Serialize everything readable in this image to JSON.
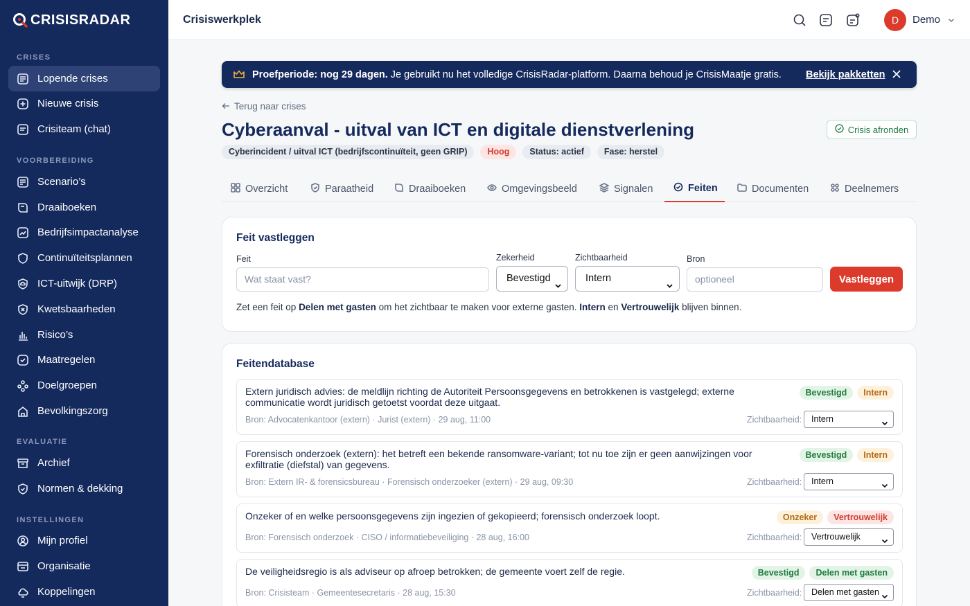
{
  "app": {
    "brand": "CRISISRADAR",
    "workspace_title": "Crisiswerkplek",
    "user_initial": "D",
    "user_name": "Demo",
    "accent": "#dc3b2c",
    "navy": "#14295c"
  },
  "sidebar": {
    "sections": [
      {
        "title": "CRISES",
        "items": [
          {
            "label": "Lopende crises",
            "icon": "list-alert-icon",
            "active": true
          },
          {
            "label": "Nieuwe crisis",
            "icon": "plus-circle-icon"
          },
          {
            "label": "Crisiteam (chat)",
            "icon": "chat-icon"
          }
        ]
      },
      {
        "title": "VOORBEREIDING",
        "items": [
          {
            "label": "Scenario’s",
            "icon": "scenario-icon"
          },
          {
            "label": "Draaiboeken",
            "icon": "book-icon"
          },
          {
            "label": "Bedrijfsimpactanalyse",
            "icon": "impact-icon"
          },
          {
            "label": "Continuïteitsplannen",
            "icon": "shield-icon"
          },
          {
            "label": "ICT-uitwijk (DRP)",
            "icon": "shield-cloud-icon"
          },
          {
            "label": "Kwetsbaarheden",
            "icon": "shield-x-icon"
          },
          {
            "label": "Risico’s",
            "icon": "bar-chart-icon"
          },
          {
            "label": "Maatregelen",
            "icon": "check-badge-icon"
          },
          {
            "label": "Doelgroepen",
            "icon": "users-icon"
          },
          {
            "label": "Bevolkingszorg",
            "icon": "house-icon"
          }
        ]
      },
      {
        "title": "EVALUATIE",
        "items": [
          {
            "label": "Archief",
            "icon": "archive-icon"
          },
          {
            "label": "Normen & dekking",
            "icon": "target-icon"
          }
        ]
      },
      {
        "title": "INSTELLINGEN",
        "items": [
          {
            "label": "Mijn profiel",
            "icon": "user-circle-icon"
          },
          {
            "label": "Organisatie",
            "icon": "building-icon"
          },
          {
            "label": "Koppelingen",
            "icon": "cloud-icon"
          }
        ]
      }
    ]
  },
  "banner": {
    "bold": "Proefperiode: nog 29 dagen.",
    "text": " Je gebruikt nu het volledige CrisisRadar-platform. Daarna behoud je CrisisMaatje gratis.",
    "link": "Bekijk pakketten"
  },
  "header": {
    "back": "Terug naar crises",
    "title": "Cyberaanval - uitval van ICT en digitale dienstverlening",
    "finish_button": "Crisis afronden",
    "badges": [
      "Cyberincident / uitval ICT (bedrijfscontinuïteit, geen GRIP)",
      "Hoog",
      "Status: actief",
      "Fase: herstel"
    ]
  },
  "tabs": [
    "Overzicht",
    "Paraatheid",
    "Draaiboeken",
    "Omgevingsbeeld",
    "Signalen",
    "Feiten",
    "Documenten",
    "Deelnemers"
  ],
  "active_tab": "Feiten",
  "form": {
    "title": "Feit vastleggen",
    "feit_label": "Feit",
    "feit_placeholder": "Wat staat vast?",
    "zekerheid_label": "Zekerheid",
    "zekerheid_value": "Bevestigd",
    "zicht_label": "Zichtbaarheid",
    "zicht_value": "Intern",
    "bron_label": "Bron",
    "bron_placeholder": "optioneel",
    "submit": "Vastleggen",
    "hint_1": "Zet een feit op ",
    "hint_2": "Delen met gasten",
    "hint_3": " om het zichtbaar te maken voor externe gasten. ",
    "hint_4": "Intern",
    "hint_5": " en ",
    "hint_6": "Vertrouwelijk",
    "hint_7": " blijven binnen."
  },
  "facts": {
    "title": "Feitendatabase",
    "vis_label": "Zichtbaarheid:",
    "items": [
      {
        "text": "Extern juridisch advies: de meldlijn richting de Autoriteit Persoonsgegevens en betrokkenen is vastgelegd; externe communicatie wordt juridisch getoetst voordat deze uitgaat.",
        "meta": "Bron: Advocatenkantoor (extern) · Jurist (extern) · 29 aug, 11:00",
        "badge1": "Bevestigd",
        "badge2": "Intern",
        "visibility": "Intern"
      },
      {
        "text": "Forensisch onderzoek (extern): het betreft een bekende ransomware-variant; tot nu toe zijn er geen aanwijzingen voor exfiltratie (diefstal) van gegevens.",
        "meta": "Bron: Extern IR- & forensicsbureau · Forensisch onderzoeker (extern) · 29 aug, 09:30",
        "badge1": "Bevestigd",
        "badge2": "Intern",
        "visibility": "Intern"
      },
      {
        "text": "Onzeker of en welke persoonsgegevens zijn ingezien of gekopieerd; forensisch onderzoek loopt.",
        "meta": "Bron: Forensisch onderzoek · CISO / informatiebeveiliging · 28 aug, 16:00",
        "badge1": "Onzeker",
        "badge2": "Vertrouwelijk",
        "visibility": "Vertrouwelijk"
      },
      {
        "text": "De veiligheidsregio is als adviseur op afroep betrokken; de gemeente voert zelf de regie.",
        "meta": "Bron: Crisisteam · Gemeentesecretaris · 28 aug, 15:30",
        "badge1": "Bevestigd",
        "badge2": "Delen met gasten",
        "visibility": "Delen met gasten"
      }
    ]
  }
}
